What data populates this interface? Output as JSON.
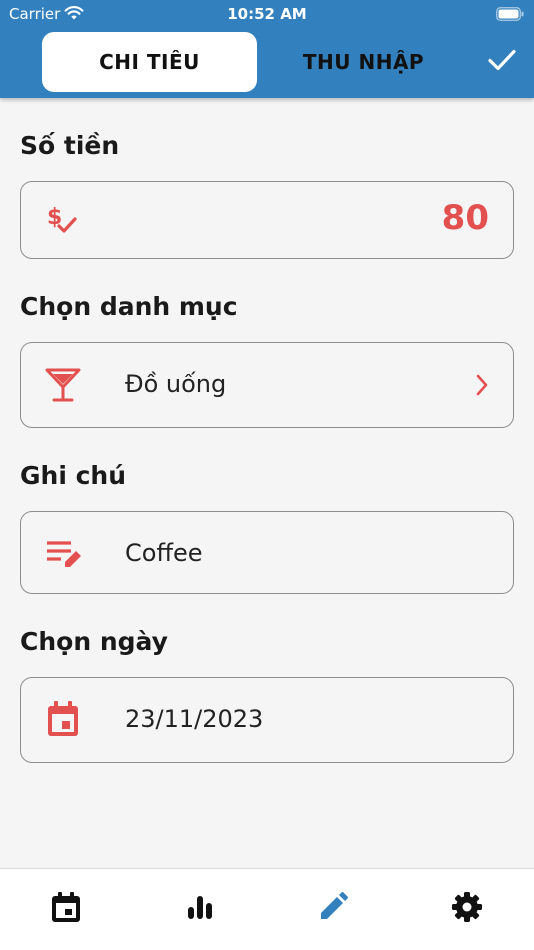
{
  "status_bar": {
    "carrier": "Carrier",
    "time": "10:52 AM",
    "wifi_icon": "wifi-icon",
    "battery_icon": "battery-icon"
  },
  "header": {
    "tabs": [
      {
        "label": "CHI TIÊU",
        "active": true
      },
      {
        "label": "THU NHẬP",
        "active": false
      }
    ],
    "confirm_icon": "check-icon",
    "background_color": "#3280bd"
  },
  "form": {
    "amount": {
      "label": "Số tiền",
      "value": "80",
      "icon": "dollar-check-icon"
    },
    "category": {
      "label": "Chọn danh mục",
      "value": "Đồ uống",
      "icon": "cocktail-icon",
      "chevron_icon": "chevron-right-icon"
    },
    "note": {
      "label": "Ghi chú",
      "value": "Coffee",
      "icon": "edit-note-icon"
    },
    "date": {
      "label": "Chọn ngày",
      "value": "23/11/2023",
      "icon": "calendar-icon"
    }
  },
  "accent_color": "#e35050",
  "bottom_nav": {
    "items": [
      {
        "icon": "calendar-icon",
        "active": false
      },
      {
        "icon": "bar-chart-icon",
        "active": false
      },
      {
        "icon": "pencil-icon",
        "active": true
      },
      {
        "icon": "settings-icon",
        "active": false
      }
    ],
    "active_color": "#3280bd"
  }
}
